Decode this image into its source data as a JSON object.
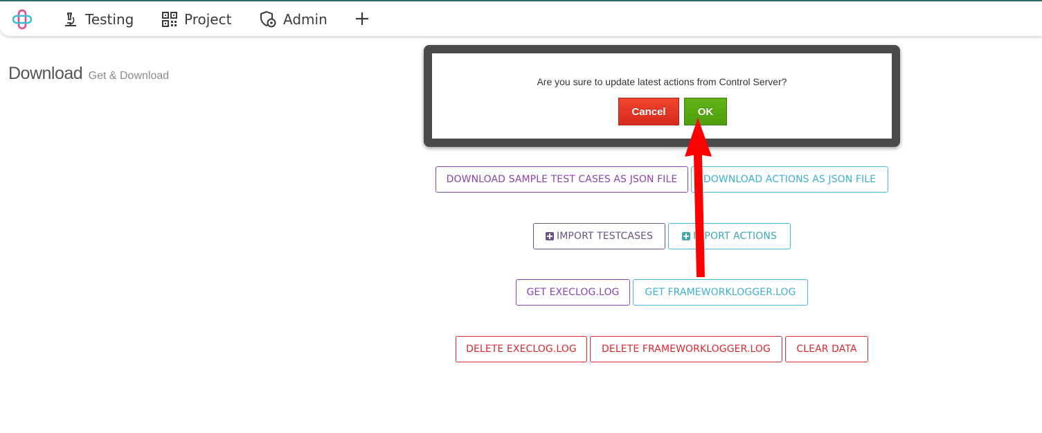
{
  "nav": {
    "items": [
      {
        "label": "Testing",
        "icon": "microscope-icon"
      },
      {
        "label": "Project",
        "icon": "qr-grid-icon"
      },
      {
        "label": "Admin",
        "icon": "shield-gear-icon"
      }
    ],
    "add_icon": "plus-icon"
  },
  "page": {
    "title": "Download",
    "subtitle": "Get & Download"
  },
  "buttons": {
    "download_sample": "DOWNLOAD SAMPLE TEST CASES AS JSON FILE",
    "download_actions": "DOWNLOAD ACTIONS AS JSON FILE",
    "import_testcases": "IMPORT TESTCASES",
    "import_actions": "IMPORT ACTIONS",
    "get_execlog": "GET EXECLOG.LOG",
    "get_frameworklogger": "GET FRAMEWORKLOGGER.LOG",
    "delete_execlog": "DELETE EXECLOG.LOG",
    "delete_frameworklogger": "DELETE FRAMEWORKLOGGER.LOG",
    "clear_data": "CLEAR DATA"
  },
  "dialog": {
    "message": "Are you sure to update latest actions from Control Server?",
    "cancel_label": "Cancel",
    "ok_label": "OK"
  },
  "colors": {
    "purple": "#8b44ac",
    "cyan": "#46b8da",
    "red": "#d9282f",
    "ok_green": "#5aab12",
    "cancel_red": "#e63a26",
    "annotation_arrow": "#ff0000"
  }
}
